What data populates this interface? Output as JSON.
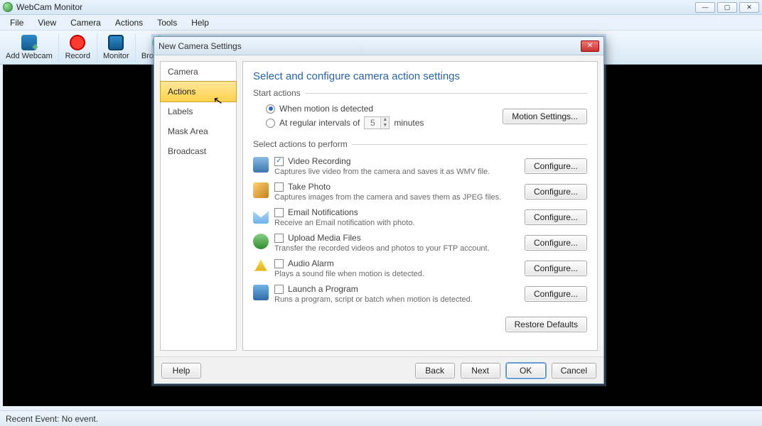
{
  "app": {
    "title": "WebCam Monitor",
    "menus": [
      "File",
      "View",
      "Camera",
      "Actions",
      "Tools",
      "Help"
    ],
    "toolbar": [
      {
        "id": "add-webcam",
        "label": "Add Webcam"
      },
      {
        "id": "record",
        "label": "Record"
      },
      {
        "id": "monitor",
        "label": "Monitor"
      },
      {
        "id": "broadcast",
        "label": "Broadcast"
      }
    ],
    "status": "Recent Event: No event."
  },
  "dialog": {
    "title": "New Camera Settings",
    "nav": [
      {
        "id": "camera",
        "label": "Camera",
        "selected": false
      },
      {
        "id": "actions",
        "label": "Actions",
        "selected": true
      },
      {
        "id": "labels",
        "label": "Labels",
        "selected": false
      },
      {
        "id": "mask",
        "label": "Mask Area",
        "selected": false
      },
      {
        "id": "broadcast",
        "label": "Broadcast",
        "selected": false
      }
    ],
    "heading": "Select and configure camera action settings",
    "start": {
      "legend": "Start actions",
      "motion_label": "When motion is detected",
      "motion_checked": true,
      "interval_label_pre": "At regular intervals of",
      "interval_value": "5",
      "interval_label_post": "minutes",
      "interval_checked": false,
      "motion_settings_btn": "Motion Settings..."
    },
    "actions": {
      "legend": "Select actions to perform",
      "items": [
        {
          "id": "video",
          "checked": true,
          "title": "Video Recording",
          "desc": "Captures live video from the camera and saves it as WMV file.",
          "btn": "Configure..."
        },
        {
          "id": "photo",
          "checked": false,
          "title": "Take Photo",
          "desc": "Captures images from the camera and saves them as JPEG files.",
          "btn": "Configure..."
        },
        {
          "id": "email",
          "checked": false,
          "title": "Email Notifications",
          "desc": "Receive an Email notification with photo.",
          "btn": "Configure..."
        },
        {
          "id": "ftp",
          "checked": false,
          "title": "Upload Media Files",
          "desc": "Transfer the recorded videos and photos to your FTP account.",
          "btn": "Configure..."
        },
        {
          "id": "alarm",
          "checked": false,
          "title": "Audio Alarm",
          "desc": "Plays a sound file when motion is detected.",
          "btn": "Configure..."
        },
        {
          "id": "launch",
          "checked": false,
          "title": "Launch a Program",
          "desc": "Runs a program, script or batch when motion is detected.",
          "btn": "Configure..."
        }
      ],
      "restore_btn": "Restore Defaults"
    },
    "footer": {
      "help": "Help",
      "back": "Back",
      "next": "Next",
      "ok": "OK",
      "cancel": "Cancel"
    }
  }
}
